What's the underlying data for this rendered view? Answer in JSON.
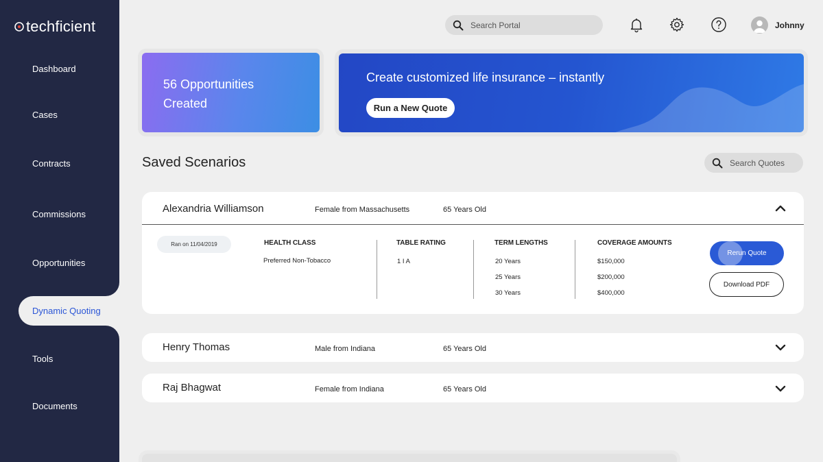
{
  "brand": {
    "name": "techficient"
  },
  "sidebar": {
    "items": [
      {
        "label": "Dashboard"
      },
      {
        "label": "Cases"
      },
      {
        "label": "Contracts"
      },
      {
        "label": "Commissions"
      },
      {
        "label": "Opportunities"
      },
      {
        "label": "Dynamic Quoting",
        "active": true
      },
      {
        "label": "Tools"
      },
      {
        "label": "Documents"
      }
    ]
  },
  "header": {
    "search_placeholder": "Search Portal",
    "icons": [
      "bell-icon",
      "gear-icon",
      "help-icon"
    ],
    "user_name": "Johnny"
  },
  "banners": {
    "opportunities_text": "56 Opportunities Created",
    "quote_headline": "Create customized life insurance – instantly",
    "quote_button": "Run a New Quote"
  },
  "saved": {
    "title": "Saved Scenarios",
    "search_placeholder": "Search Quotes",
    "scenarios": [
      {
        "name": "Alexandria Williamson",
        "description": "Female from Massachusetts",
        "age": "65 Years Old",
        "expanded": true,
        "ran_on": "Ran on 11/04/2019",
        "health_class_label": "HEALTH CLASS",
        "health_class": "Preferred Non-Tobacco",
        "table_rating_label": "TABLE RATING",
        "table_rating": "1 I A",
        "term_lengths_label": "TERM LENGTHS",
        "term_lengths": [
          "20 Years",
          "25 Years",
          "30 Years"
        ],
        "coverage_label": "COVERAGE AMOUNTS",
        "coverage_amounts": [
          "$150,000",
          "$200,000",
          "$400,000"
        ],
        "rerun_label": "Rerun Quote",
        "download_label": "Download PDF"
      },
      {
        "name": "Henry Thomas",
        "description": "Male from Indiana",
        "age": "65 Years Old",
        "expanded": false
      },
      {
        "name": "Raj Bhagwat",
        "description": "Female from Indiana",
        "age": "65 Years Old",
        "expanded": false
      }
    ]
  },
  "colors": {
    "sidebar": "#222844",
    "accent": "#2a5ad6",
    "background": "#efefef"
  }
}
